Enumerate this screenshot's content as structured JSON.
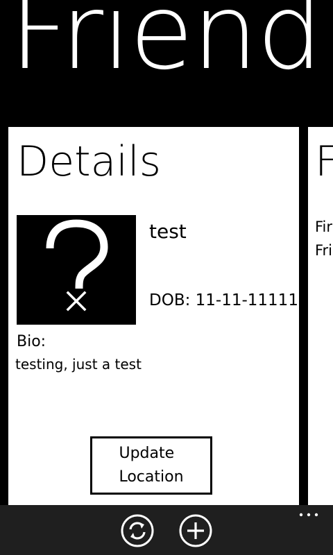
{
  "pivot": {
    "title": "Friend"
  },
  "details_panel": {
    "header": "Details",
    "name": "test",
    "dob": "DOB: 11-11-11111",
    "bio_label": "Bio:",
    "bio_text": "testing, just a test",
    "update_button_label": "Update\nLocation"
  },
  "next_panel": {
    "header": "F",
    "line1": "Fir",
    "line2": "Fri"
  },
  "app_bar": {
    "buttons": [
      {
        "icon": "refresh-icon"
      },
      {
        "icon": "add-icon"
      }
    ],
    "more_icon": "ellipsis-icon"
  },
  "colors": {
    "background": "#000000",
    "panel": "#ffffff",
    "app_bar": "#1f1f1f",
    "foreground": "#000000"
  }
}
